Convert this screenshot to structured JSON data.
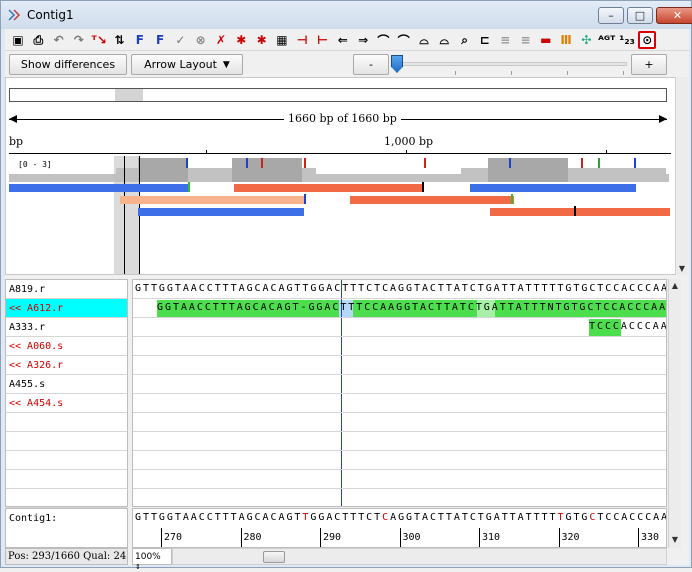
{
  "window": {
    "title": "Contig1",
    "buttons": [
      "–",
      "□",
      "✕"
    ]
  },
  "toolbar": {
    "icons": [
      "save-icon",
      "print-icon",
      "undo-icon",
      "redo-icon",
      "trim-icon",
      "sort-icon",
      "find-forward-icon",
      "find-forward-alt-icon",
      "check-icon",
      "cancel-icon",
      "remove-icon",
      "star-left-icon",
      "star-right-icon",
      "binoculars-icon",
      "insert-gap-icon",
      "delete-gap-icon",
      "shift-left-icon",
      "shift-right-icon",
      "shift-up-icon",
      "shift-down-icon",
      "collapse-icon",
      "expand-icon",
      "zoom-icon",
      "tree-icon",
      "align-icon",
      "align-alt-icon",
      "flag-icon",
      "chromatogram-icon",
      "primer-icon",
      "translate-icon",
      "number-icon",
      "link-icon"
    ],
    "glyphs": [
      "▣",
      "⎙",
      "↶",
      "↷",
      "ᵀ↘",
      "⇅",
      "F",
      "F",
      "✓",
      "⊗",
      "✗",
      "✱",
      "✱",
      "▦",
      "⊣",
      "⊢",
      "⇐",
      "⇒",
      "⌒",
      "⌒",
      "⌓",
      "⌓",
      "⌕",
      "⊏",
      "≡",
      "≡",
      "▬",
      "Ⅲ",
      "✣",
      "ᴬᴳᵀ",
      "¹₂₃",
      "⊙"
    ]
  },
  "controls": {
    "show_differences": "Show differences",
    "arrow_layout": "Arrow Layout",
    "dropdown_glyph": "▼",
    "zoom_out": "-",
    "zoom_in": "+"
  },
  "overview": {
    "length_label": "1660 bp of 1660 bp",
    "scale_left": "bp",
    "scale_mid": "1,000 bp",
    "coverage_range": "[0 - 3]"
  },
  "reads": [
    {
      "name": "A819.r",
      "selected": false,
      "reverse": false,
      "sequence": "GTTGGTAACCTTTAGCACAGTTGGACTTTCTCAGGTACTTATCTGATTATTTTTGTGCTCCACCCAA"
    },
    {
      "name": "<< A612.r",
      "selected": true,
      "reverse": true,
      "sequence": "GGTAACCTTTAGCACAGT-GGACTTTCCAAGGTACTTATCTGATTATTTNTGTGCTCCACCCAA"
    },
    {
      "name": "A333.r",
      "selected": false,
      "reverse": false,
      "sequence": "TCCCACCCAA"
    },
    {
      "name": "<< A060.s",
      "selected": false,
      "reverse": true,
      "sequence": ""
    },
    {
      "name": "<< A326.r",
      "selected": false,
      "reverse": true,
      "sequence": ""
    },
    {
      "name": "A455.s",
      "selected": false,
      "reverse": false,
      "sequence": ""
    },
    {
      "name": "<< A454.s",
      "selected": false,
      "reverse": true,
      "sequence": ""
    }
  ],
  "consensus": {
    "name": "Contig1:",
    "sequence_parts": [
      "GTTGGTAACCTTTAGCACAGT",
      "T",
      "GGACTTTCT",
      "C",
      "AGGTACTTATCTGATTATTTT",
      "T",
      "GTG",
      "C",
      "TCCACCCAA"
    ],
    "positions": [
      "270",
      "280",
      "290",
      "300",
      "310",
      "320",
      "330"
    ]
  },
  "status": {
    "position": "Pos: 293/1660  Qual: 24",
    "zoom": "100%"
  }
}
